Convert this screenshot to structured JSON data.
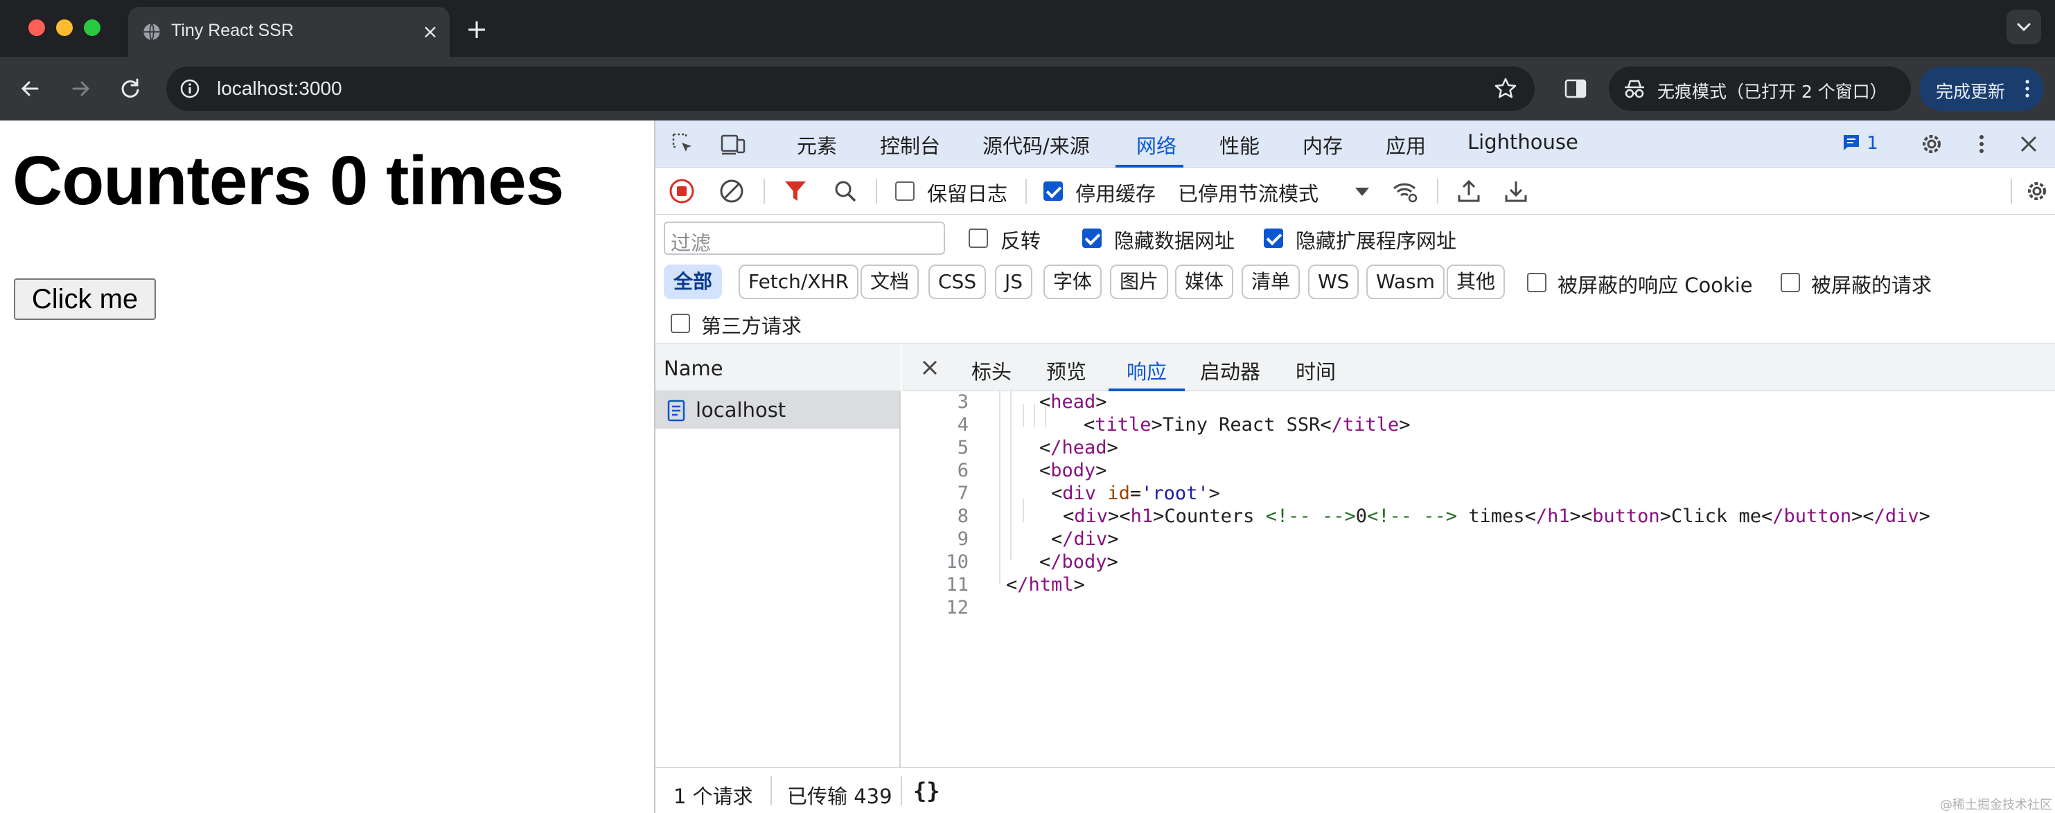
{
  "browser": {
    "tab_title": "Tiny React SSR",
    "url": "localhost:3000",
    "incognito_label": "无痕模式（已打开 2 个窗口）",
    "update_label": "完成更新"
  },
  "page": {
    "heading": "Counters 0 times",
    "button_label": "Click me"
  },
  "devtools": {
    "tabs": [
      "元素",
      "控制台",
      "源代码/来源",
      "网络",
      "性能",
      "内存",
      "应用",
      "Lighthouse"
    ],
    "active_tab": "网络",
    "issues_count": "1",
    "toolbar": {
      "preserve_log": "保留日志",
      "disable_cache": "停用缓存",
      "throttle": "已停用节流模式"
    },
    "filter": {
      "placeholder": "过滤",
      "invert": "反转",
      "hide_data_urls": "隐藏数据网址",
      "hide_extension_urls": "隐藏扩展程序网址",
      "type_chips": [
        "全部",
        "Fetch/XHR",
        "文档",
        "CSS",
        "JS",
        "字体",
        "图片",
        "媒体",
        "清单",
        "WS",
        "Wasm",
        "其他"
      ],
      "blocked_cookies": "被屏蔽的响应 Cookie",
      "blocked_requests": "被屏蔽的请求",
      "third_party": "第三方请求"
    },
    "requests": {
      "column_header": "Name",
      "items": [
        "localhost"
      ]
    },
    "detail_tabs": [
      "标头",
      "预览",
      "响应",
      "启动器",
      "时间"
    ],
    "active_detail_tab": "响应",
    "response_lines": [
      {
        "n": "3",
        "text": "<head>"
      },
      {
        "n": "4",
        "text": "<title>Tiny React SSR</title>"
      },
      {
        "n": "5",
        "text": "</head>"
      },
      {
        "n": "6",
        "text": "<body>"
      },
      {
        "n": "7",
        "text": "<div id='root'>"
      },
      {
        "n": "8",
        "text": "<div><h1>Counters <!-- -->0<!-- --> times</h1><button>Click me</button></div>"
      },
      {
        "n": "9",
        "text": "</div>"
      },
      {
        "n": "10",
        "text": "</body>"
      },
      {
        "n": "11",
        "text": "</html>"
      },
      {
        "n": "12",
        "text": ""
      }
    ],
    "status": {
      "requests": "1 个请求",
      "transferred": "已传输 439",
      "pretty_print": "{}"
    }
  },
  "watermark": "@稀土掘金技术社区"
}
